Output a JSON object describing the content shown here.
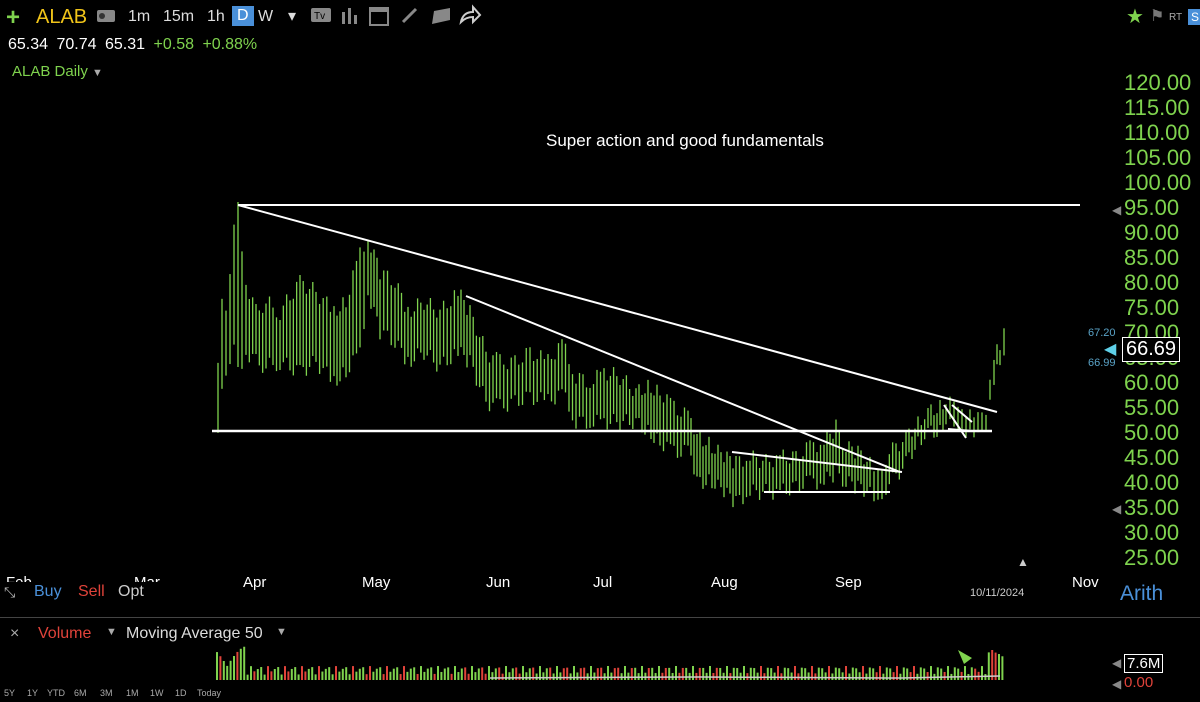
{
  "toolbar": {
    "symbol": "ALAB",
    "intervals": [
      "1m",
      "15m",
      "1h",
      "D",
      "W"
    ],
    "active_interval": "D",
    "rt_label": "RT",
    "s_label": "S"
  },
  "quote": {
    "open": "65.34",
    "high": "70.74",
    "low": "65.31",
    "change": "+0.58",
    "change_pct": "+0.88%"
  },
  "chart_title": "ALAB Daily",
  "annotation": "Super action and good fundamentals",
  "price_axis": {
    "ticks": [
      "120.00",
      "115.00",
      "110.00",
      "105.00",
      "100.00",
      "95.00",
      "90.00",
      "85.00",
      "80.00",
      "75.00",
      "70.00",
      "65.00",
      "60.00",
      "55.00",
      "50.00",
      "45.00",
      "40.00",
      "35.00",
      "30.00",
      "25.00"
    ],
    "high_marker": "67.20",
    "low_marker": "66.99",
    "current": "66.69",
    "scale_label": "Arith"
  },
  "time_axis": {
    "months": [
      "Feb",
      "Mar",
      "Apr",
      "May",
      "Jun",
      "Jul",
      "Aug",
      "Sep",
      "Nov"
    ],
    "current_date": "10/11/2024"
  },
  "trade_buttons": {
    "buy": "Buy",
    "sell": "Sell",
    "opt": "Opt"
  },
  "volume_panel": {
    "label": "Volume",
    "ma_label": "Moving Average 50",
    "value": "7.6M",
    "zero": "0.00"
  },
  "range_buttons": [
    "5Y",
    "1Y",
    "YTD",
    "6M",
    "3M",
    "1M",
    "1W",
    "1D",
    "Today"
  ],
  "colors": {
    "up": "#7fd34e",
    "down": "#e0433a",
    "accent": "#4a90d9",
    "line": "#ffffff"
  },
  "chart_data": {
    "type": "bar",
    "title": "ALAB Daily",
    "ylim": [
      25,
      120
    ],
    "ohlc_sample": [
      {
        "date": "2024-03-20",
        "low": 50,
        "high": 64
      },
      {
        "date": "2024-03-22",
        "low": 62,
        "high": 95
      },
      {
        "date": "2024-04-01",
        "low": 65,
        "high": 80
      },
      {
        "date": "2024-04-30",
        "low": 78,
        "high": 89
      },
      {
        "date": "2024-05-20",
        "low": 68,
        "high": 78
      },
      {
        "date": "2024-06-10",
        "low": 63,
        "high": 70
      },
      {
        "date": "2024-07-01",
        "low": 58,
        "high": 67
      },
      {
        "date": "2024-08-05",
        "low": 37,
        "high": 45
      },
      {
        "date": "2024-09-06",
        "low": 38,
        "high": 44
      },
      {
        "date": "2024-09-20",
        "low": 50,
        "high": 56
      },
      {
        "date": "2024-10-11",
        "low": 65.31,
        "high": 70.74
      }
    ]
  }
}
